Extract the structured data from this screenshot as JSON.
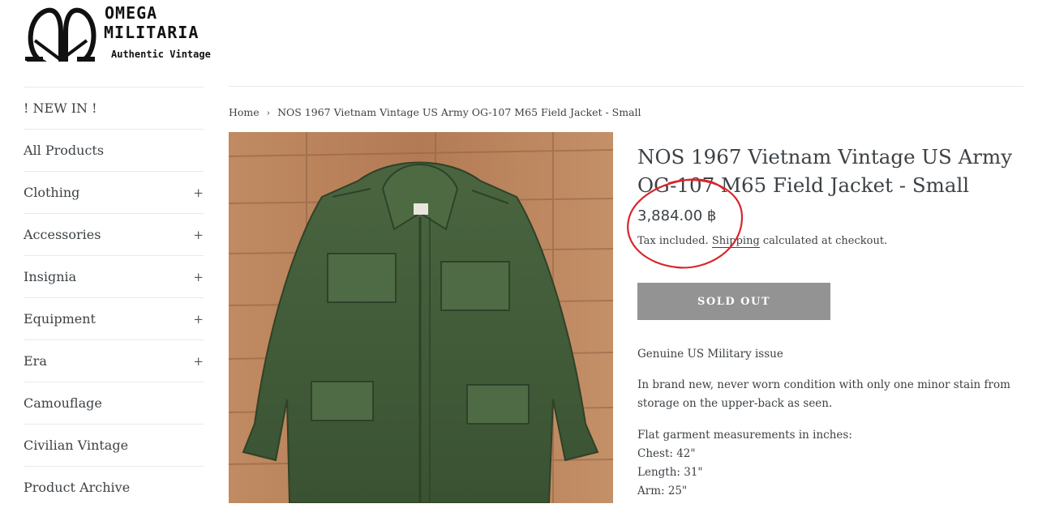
{
  "logo": {
    "line1": "OMEGA",
    "line2": "MILITARIA",
    "tagline": "Authentic Vintage"
  },
  "sidebar": {
    "items": [
      {
        "label": "! NEW IN !",
        "expandable": false
      },
      {
        "label": "All Products",
        "expandable": false
      },
      {
        "label": "Clothing",
        "expandable": true
      },
      {
        "label": "Accessories",
        "expandable": true
      },
      {
        "label": "Insignia",
        "expandable": true
      },
      {
        "label": "Equipment",
        "expandable": true
      },
      {
        "label": "Era",
        "expandable": true
      },
      {
        "label": "Camouflage",
        "expandable": false
      },
      {
        "label": "Civilian Vintage",
        "expandable": false
      },
      {
        "label": "Product Archive",
        "expandable": false
      }
    ],
    "expand_symbol": "+"
  },
  "breadcrumb": {
    "home": "Home",
    "separator": "›",
    "current": "NOS 1967 Vietnam Vintage US Army OG-107 M65 Field Jacket - Small"
  },
  "product": {
    "title": "NOS 1967 Vietnam Vintage US Army OG-107 M65 Field Jacket - Small",
    "price": "3,884.00 ฿",
    "tax_prefix": "Tax included. ",
    "shipping_link": "Shipping",
    "tax_suffix": " calculated at checkout.",
    "button_label": "SOLD OUT",
    "description": {
      "line1": "Genuine US Military issue",
      "line2": "In brand new, never worn condition with only one minor stain from storage on the upper-back as seen.",
      "measure_heading": "Flat garment measurements in inches:",
      "chest": "Chest:  42\"",
      "length": "Length:  31\"",
      "arm": "Arm:  25\""
    }
  },
  "colors": {
    "text": "#3d4246",
    "button_disabled": "#939393",
    "annotation": "#d8262b",
    "jacket": "#3f5a36",
    "wood": "#b98660"
  }
}
